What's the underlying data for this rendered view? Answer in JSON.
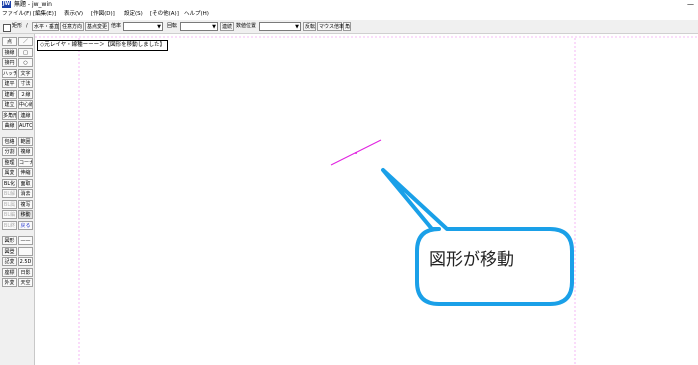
{
  "window": {
    "app_icon_label": "JW",
    "title": "無題 - jw_win",
    "minimize_glyph": "—"
  },
  "menu": [
    "ファイル(F)",
    "[編集(E)]",
    "表示(V)",
    "[作図(D)]",
    "設定(S)",
    "[その他(A)]",
    "ヘルプ(H)"
  ],
  "toolbar": {
    "rect_label": "矩形",
    "slash": "/",
    "horiz_vert": "水平・垂直",
    "any_direction": "任意方向",
    "base_point_change": "基点変更",
    "scale_label": "倍率",
    "scale_value": "",
    "rotate_label": "回転",
    "rotate_value": "",
    "continuous": "連続",
    "numeric_position": "数値位置",
    "numeric_value": "",
    "reverse": "反転",
    "mouse_scale": "マウス倍率",
    "angle": "角"
  },
  "palette": [
    [
      "点",
      "／"
    ],
    [
      "接線",
      "□"
    ],
    [
      "接円",
      "○"
    ],
    [
      "ハッチ",
      "文字"
    ],
    [
      "建平",
      "寸法"
    ],
    [
      "建断",
      "２線"
    ],
    [
      "建立",
      "中心線"
    ],
    [
      "多角形",
      "連線"
    ],
    [
      "曲線",
      "AUTO"
    ],
    [
      "包絡",
      "範囲"
    ],
    [
      "分割",
      "複線"
    ],
    [
      "整理",
      "コーナー"
    ],
    [
      "属変",
      "伸縮"
    ],
    [
      "BL化",
      "面取"
    ],
    [
      "BL解",
      "消去"
    ],
    [
      "BL属",
      "複写"
    ],
    [
      "BL編",
      "移動"
    ],
    [
      "BL終",
      "戻る"
    ],
    [
      "図形",
      "——"
    ],
    [
      "図登",
      ""
    ],
    [
      "記変",
      "2.5D"
    ],
    [
      "座標",
      "日影"
    ],
    [
      "外変",
      "天空"
    ]
  ],
  "canvas": {
    "status_message": "◇元レイヤ・線種ーーー＞【図形を移動しました】",
    "callout_text": "図形が移動",
    "colors": {
      "line": "#e020e0",
      "guide": "#f0a0f0",
      "callout_stroke": "#1aa0e8"
    }
  }
}
